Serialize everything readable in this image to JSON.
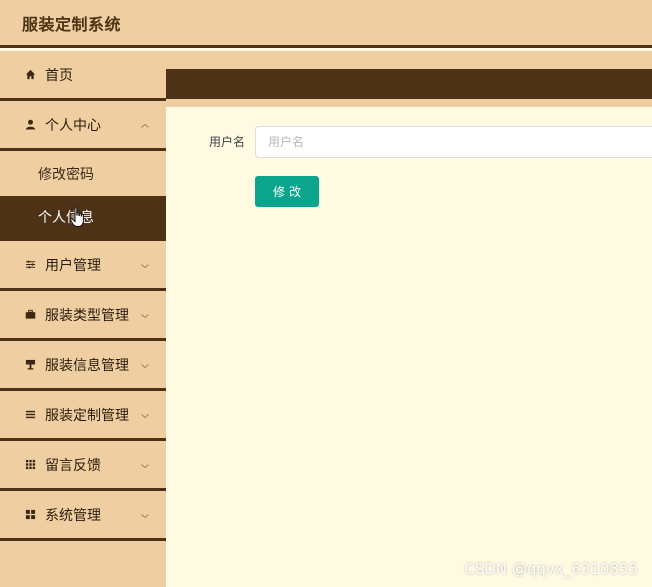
{
  "app": {
    "title": "服装定制系统"
  },
  "sidebar": {
    "items": [
      {
        "label": "首页",
        "icon": "home-icon"
      },
      {
        "label": "个人中心",
        "icon": "user-icon",
        "expanded": true,
        "children": [
          {
            "label": "修改密码"
          },
          {
            "label": "个人信息",
            "active": true
          }
        ]
      },
      {
        "label": "用户管理",
        "icon": "sliders-icon"
      },
      {
        "label": "服装类型管理",
        "icon": "briefcase-icon"
      },
      {
        "label": "服装信息管理",
        "icon": "stand-icon"
      },
      {
        "label": "服装定制管理",
        "icon": "list-icon"
      },
      {
        "label": "留言反馈",
        "icon": "grid-icon"
      },
      {
        "label": "系统管理",
        "icon": "apps-icon"
      }
    ]
  },
  "form": {
    "username_label": "用户名",
    "username_placeholder": "用户名",
    "username_value": "",
    "submit_label": "修改"
  },
  "watermark": "CSDN @qqvx_6310855",
  "colors": {
    "sidebar_bg": "#efcfa2",
    "dark_brown": "#4d3216",
    "main_bg": "#fffbe3",
    "button": "#0aa58c"
  }
}
